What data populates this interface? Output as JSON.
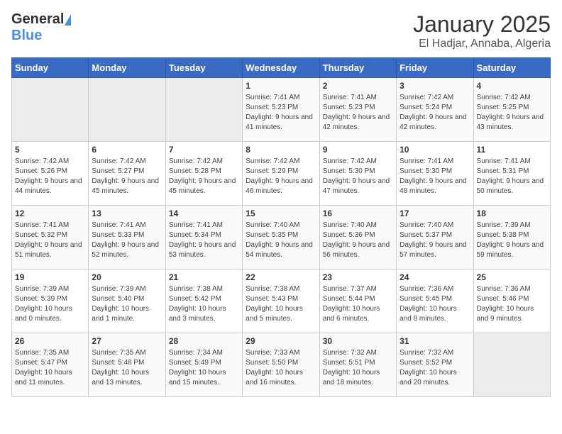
{
  "header": {
    "logo_general": "General",
    "logo_blue": "Blue",
    "title": "January 2025",
    "subtitle": "El Hadjar, Annaba, Algeria"
  },
  "days_of_week": [
    "Sunday",
    "Monday",
    "Tuesday",
    "Wednesday",
    "Thursday",
    "Friday",
    "Saturday"
  ],
  "weeks": [
    [
      {
        "day": "",
        "empty": true
      },
      {
        "day": "",
        "empty": true
      },
      {
        "day": "",
        "empty": true
      },
      {
        "day": "1",
        "sunrise": "Sunrise: 7:41 AM",
        "sunset": "Sunset: 5:23 PM",
        "daylight": "Daylight: 9 hours and 41 minutes."
      },
      {
        "day": "2",
        "sunrise": "Sunrise: 7:41 AM",
        "sunset": "Sunset: 5:23 PM",
        "daylight": "Daylight: 9 hours and 42 minutes."
      },
      {
        "day": "3",
        "sunrise": "Sunrise: 7:42 AM",
        "sunset": "Sunset: 5:24 PM",
        "daylight": "Daylight: 9 hours and 42 minutes."
      },
      {
        "day": "4",
        "sunrise": "Sunrise: 7:42 AM",
        "sunset": "Sunset: 5:25 PM",
        "daylight": "Daylight: 9 hours and 43 minutes."
      }
    ],
    [
      {
        "day": "5",
        "sunrise": "Sunrise: 7:42 AM",
        "sunset": "Sunset: 5:26 PM",
        "daylight": "Daylight: 9 hours and 44 minutes."
      },
      {
        "day": "6",
        "sunrise": "Sunrise: 7:42 AM",
        "sunset": "Sunset: 5:27 PM",
        "daylight": "Daylight: 9 hours and 45 minutes."
      },
      {
        "day": "7",
        "sunrise": "Sunrise: 7:42 AM",
        "sunset": "Sunset: 5:28 PM",
        "daylight": "Daylight: 9 hours and 45 minutes."
      },
      {
        "day": "8",
        "sunrise": "Sunrise: 7:42 AM",
        "sunset": "Sunset: 5:29 PM",
        "daylight": "Daylight: 9 hours and 46 minutes."
      },
      {
        "day": "9",
        "sunrise": "Sunrise: 7:42 AM",
        "sunset": "Sunset: 5:30 PM",
        "daylight": "Daylight: 9 hours and 47 minutes."
      },
      {
        "day": "10",
        "sunrise": "Sunrise: 7:41 AM",
        "sunset": "Sunset: 5:30 PM",
        "daylight": "Daylight: 9 hours and 48 minutes."
      },
      {
        "day": "11",
        "sunrise": "Sunrise: 7:41 AM",
        "sunset": "Sunset: 5:31 PM",
        "daylight": "Daylight: 9 hours and 50 minutes."
      }
    ],
    [
      {
        "day": "12",
        "sunrise": "Sunrise: 7:41 AM",
        "sunset": "Sunset: 5:32 PM",
        "daylight": "Daylight: 9 hours and 51 minutes."
      },
      {
        "day": "13",
        "sunrise": "Sunrise: 7:41 AM",
        "sunset": "Sunset: 5:33 PM",
        "daylight": "Daylight: 9 hours and 52 minutes."
      },
      {
        "day": "14",
        "sunrise": "Sunrise: 7:41 AM",
        "sunset": "Sunset: 5:34 PM",
        "daylight": "Daylight: 9 hours and 53 minutes."
      },
      {
        "day": "15",
        "sunrise": "Sunrise: 7:40 AM",
        "sunset": "Sunset: 5:35 PM",
        "daylight": "Daylight: 9 hours and 54 minutes."
      },
      {
        "day": "16",
        "sunrise": "Sunrise: 7:40 AM",
        "sunset": "Sunset: 5:36 PM",
        "daylight": "Daylight: 9 hours and 56 minutes."
      },
      {
        "day": "17",
        "sunrise": "Sunrise: 7:40 AM",
        "sunset": "Sunset: 5:37 PM",
        "daylight": "Daylight: 9 hours and 57 minutes."
      },
      {
        "day": "18",
        "sunrise": "Sunrise: 7:39 AM",
        "sunset": "Sunset: 5:38 PM",
        "daylight": "Daylight: 9 hours and 59 minutes."
      }
    ],
    [
      {
        "day": "19",
        "sunrise": "Sunrise: 7:39 AM",
        "sunset": "Sunset: 5:39 PM",
        "daylight": "Daylight: 10 hours and 0 minutes."
      },
      {
        "day": "20",
        "sunrise": "Sunrise: 7:39 AM",
        "sunset": "Sunset: 5:40 PM",
        "daylight": "Daylight: 10 hours and 1 minute."
      },
      {
        "day": "21",
        "sunrise": "Sunrise: 7:38 AM",
        "sunset": "Sunset: 5:42 PM",
        "daylight": "Daylight: 10 hours and 3 minutes."
      },
      {
        "day": "22",
        "sunrise": "Sunrise: 7:38 AM",
        "sunset": "Sunset: 5:43 PM",
        "daylight": "Daylight: 10 hours and 5 minutes."
      },
      {
        "day": "23",
        "sunrise": "Sunrise: 7:37 AM",
        "sunset": "Sunset: 5:44 PM",
        "daylight": "Daylight: 10 hours and 6 minutes."
      },
      {
        "day": "24",
        "sunrise": "Sunrise: 7:36 AM",
        "sunset": "Sunset: 5:45 PM",
        "daylight": "Daylight: 10 hours and 8 minutes."
      },
      {
        "day": "25",
        "sunrise": "Sunrise: 7:36 AM",
        "sunset": "Sunset: 5:46 PM",
        "daylight": "Daylight: 10 hours and 9 minutes."
      }
    ],
    [
      {
        "day": "26",
        "sunrise": "Sunrise: 7:35 AM",
        "sunset": "Sunset: 5:47 PM",
        "daylight": "Daylight: 10 hours and 11 minutes."
      },
      {
        "day": "27",
        "sunrise": "Sunrise: 7:35 AM",
        "sunset": "Sunset: 5:48 PM",
        "daylight": "Daylight: 10 hours and 13 minutes."
      },
      {
        "day": "28",
        "sunrise": "Sunrise: 7:34 AM",
        "sunset": "Sunset: 5:49 PM",
        "daylight": "Daylight: 10 hours and 15 minutes."
      },
      {
        "day": "29",
        "sunrise": "Sunrise: 7:33 AM",
        "sunset": "Sunset: 5:50 PM",
        "daylight": "Daylight: 10 hours and 16 minutes."
      },
      {
        "day": "30",
        "sunrise": "Sunrise: 7:32 AM",
        "sunset": "Sunset: 5:51 PM",
        "daylight": "Daylight: 10 hours and 18 minutes."
      },
      {
        "day": "31",
        "sunrise": "Sunrise: 7:32 AM",
        "sunset": "Sunset: 5:52 PM",
        "daylight": "Daylight: 10 hours and 20 minutes."
      },
      {
        "day": "",
        "empty": true
      }
    ]
  ]
}
